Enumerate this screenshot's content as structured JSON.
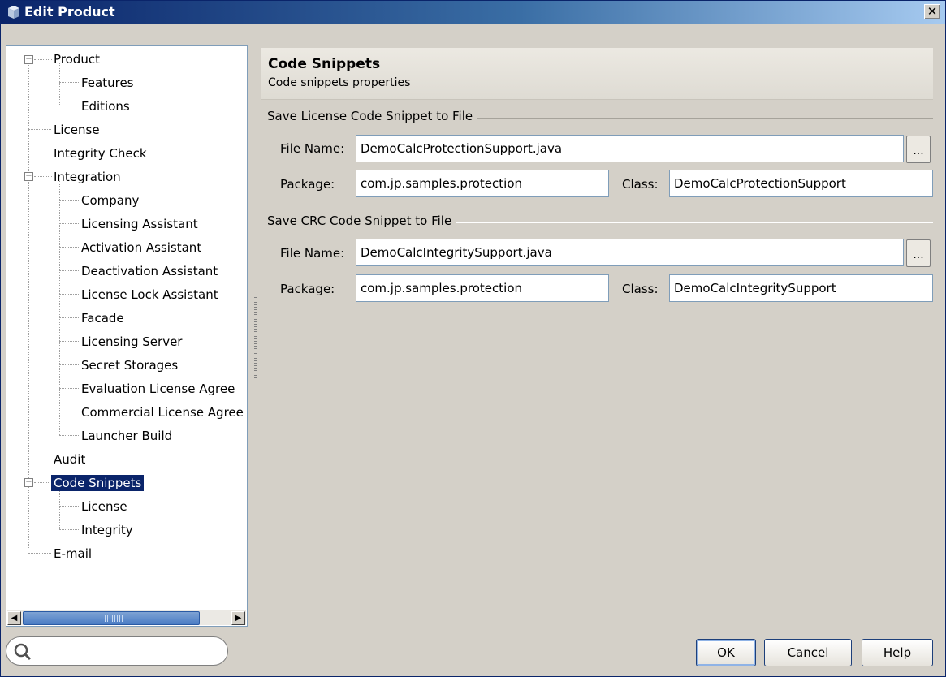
{
  "window": {
    "title": "Edit Product",
    "close_glyph": "✕"
  },
  "tree": {
    "items": [
      {
        "label": "Product",
        "level": 0,
        "expanded": true
      },
      {
        "label": "Features",
        "level": 1
      },
      {
        "label": "Editions",
        "level": 1
      },
      {
        "label": "License",
        "level": 0
      },
      {
        "label": "Integrity Check",
        "level": 0
      },
      {
        "label": "Integration",
        "level": 0,
        "expanded": true
      },
      {
        "label": "Company",
        "level": 1
      },
      {
        "label": "Licensing Assistant",
        "level": 1
      },
      {
        "label": "Activation Assistant",
        "level": 1
      },
      {
        "label": "Deactivation Assistant",
        "level": 1
      },
      {
        "label": "License Lock Assistant",
        "level": 1
      },
      {
        "label": "Facade",
        "level": 1
      },
      {
        "label": "Licensing Server",
        "level": 1
      },
      {
        "label": "Secret Storages",
        "level": 1
      },
      {
        "label": "Evaluation License Agree",
        "level": 1
      },
      {
        "label": "Commercial License Agree",
        "level": 1
      },
      {
        "label": "Launcher Build",
        "level": 1
      },
      {
        "label": "Audit",
        "level": 0
      },
      {
        "label": "Code Snippets",
        "level": 0,
        "expanded": true,
        "selected": true
      },
      {
        "label": "License",
        "level": 1
      },
      {
        "label": "Integrity",
        "level": 1
      },
      {
        "label": "E-mail",
        "level": 0
      }
    ],
    "collapse_glyph": "−",
    "scroll_left_glyph": "◀",
    "scroll_right_glyph": "▶"
  },
  "search": {
    "value": "",
    "placeholder": ""
  },
  "header": {
    "title": "Code Snippets",
    "subtitle": "Code snippets properties"
  },
  "license_section": {
    "title": "Save License Code Snippet to File",
    "file_name_label": "File Name:",
    "file_name_value": "DemoCalcProtectionSupport.java",
    "browse_label": "...",
    "package_label": "Package:",
    "package_value": "com.jp.samples.protection",
    "class_label": "Class:",
    "class_value": "DemoCalcProtectionSupport"
  },
  "crc_section": {
    "title": "Save CRC Code Snippet to File",
    "file_name_label": "File Name:",
    "file_name_value": "DemoCalcIntegritySupport.java",
    "browse_label": "...",
    "package_label": "Package:",
    "package_value": "com.jp.samples.protection",
    "class_label": "Class:",
    "class_value": "DemoCalcIntegritySupport"
  },
  "buttons": {
    "ok": "OK",
    "cancel": "Cancel",
    "help": "Help"
  },
  "colors": {
    "selection": "#0a246a",
    "title_gradient_start": "#0a246a",
    "title_gradient_end": "#a6caf0",
    "dialog_background": "#d4d0c8"
  }
}
